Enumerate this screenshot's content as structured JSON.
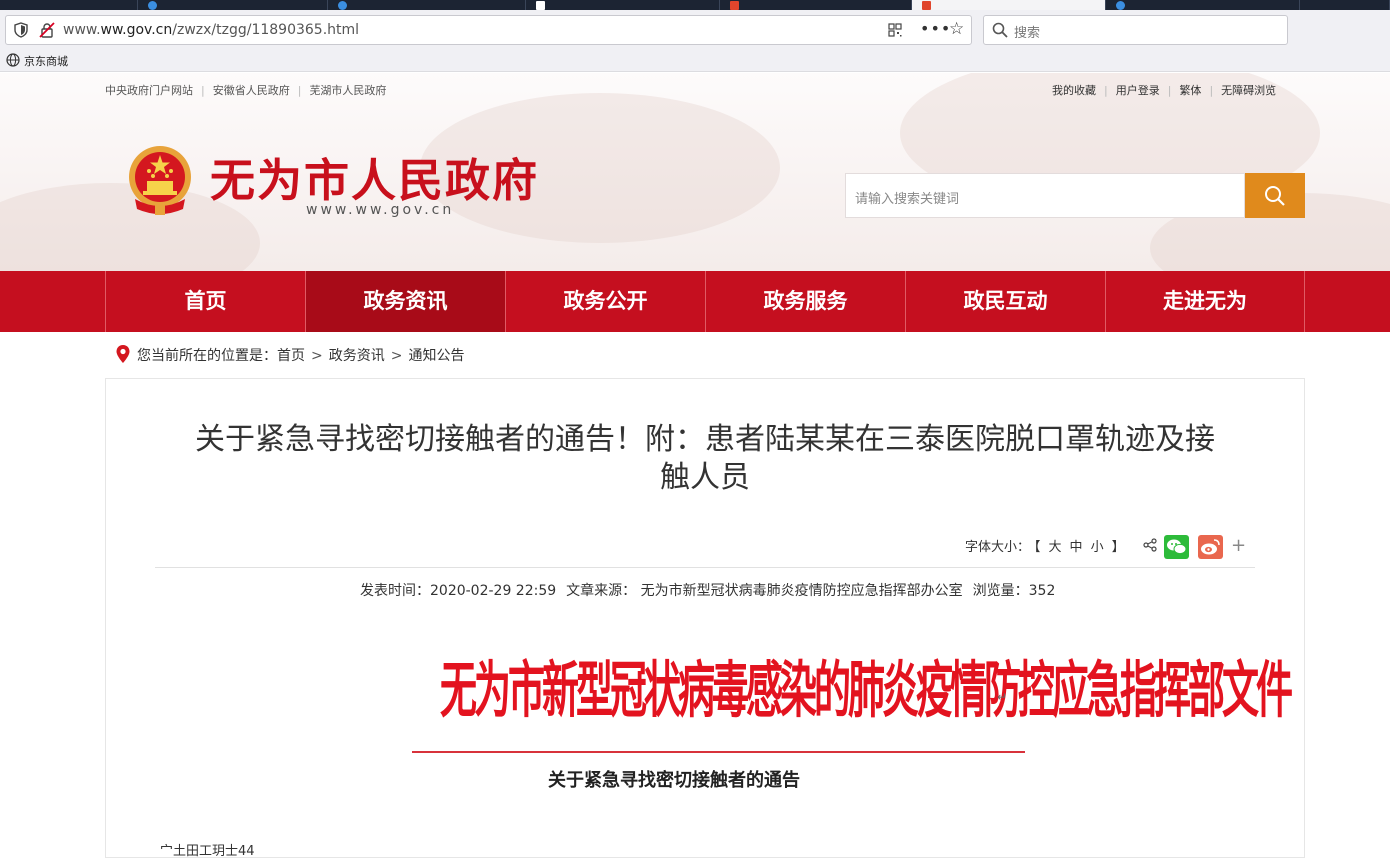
{
  "browser": {
    "url_prefix": "www.",
    "url_domain": "ww.gov.cn",
    "url_path": "/zwzx/tzgg/11890365.html",
    "search_placeholder": "搜索",
    "bookmark_label": "京东商城"
  },
  "topbar": {
    "left_links": [
      "中央政府门户网站",
      "安徽省人民政府",
      "芜湖市人民政府"
    ],
    "right_links": [
      "我的收藏",
      "用户登录",
      "繁体",
      "无障碍浏览"
    ]
  },
  "header": {
    "site_title": "无为市人民政府",
    "site_url": "www.ww.gov.cn",
    "search_placeholder": "请输入搜索关键词"
  },
  "nav": {
    "items": [
      "首页",
      "政务资讯",
      "政务公开",
      "政务服务",
      "政民互动",
      "走进无为"
    ],
    "active_index": 1
  },
  "breadcrumb": {
    "prefix": "您当前所在的位置是：",
    "items": [
      "首页",
      "政务资讯",
      "通知公告"
    ]
  },
  "article": {
    "title_line1": "关于紧急寻找密切接触者的通告！附：患者陆某某在三泰医院脱口罩轨迹及接",
    "title_line2": "触人员",
    "font_size_label": "字体大小：",
    "font_sizes": [
      "【",
      "大",
      "中",
      "小",
      "】"
    ],
    "meta_time": "发表时间：2020-02-29 22:59",
    "meta_source": "文章来源： 无为市新型冠状病毒肺炎疫情防控应急指挥部办公室",
    "meta_views": "浏览量：352",
    "doc_header": "无为市新型冠状病毒感染的肺炎疫情防控应急指挥部文件",
    "doc_return_mark": "↵",
    "notice_title": "关于紧急寻找密切接触者的通告",
    "cut_line": "宀土田工玥士44"
  },
  "colors": {
    "brand_red": "#c50f1f",
    "nav_active": "#a80b18",
    "search_orange": "#e08a1c",
    "doc_red": "#e3131f"
  }
}
